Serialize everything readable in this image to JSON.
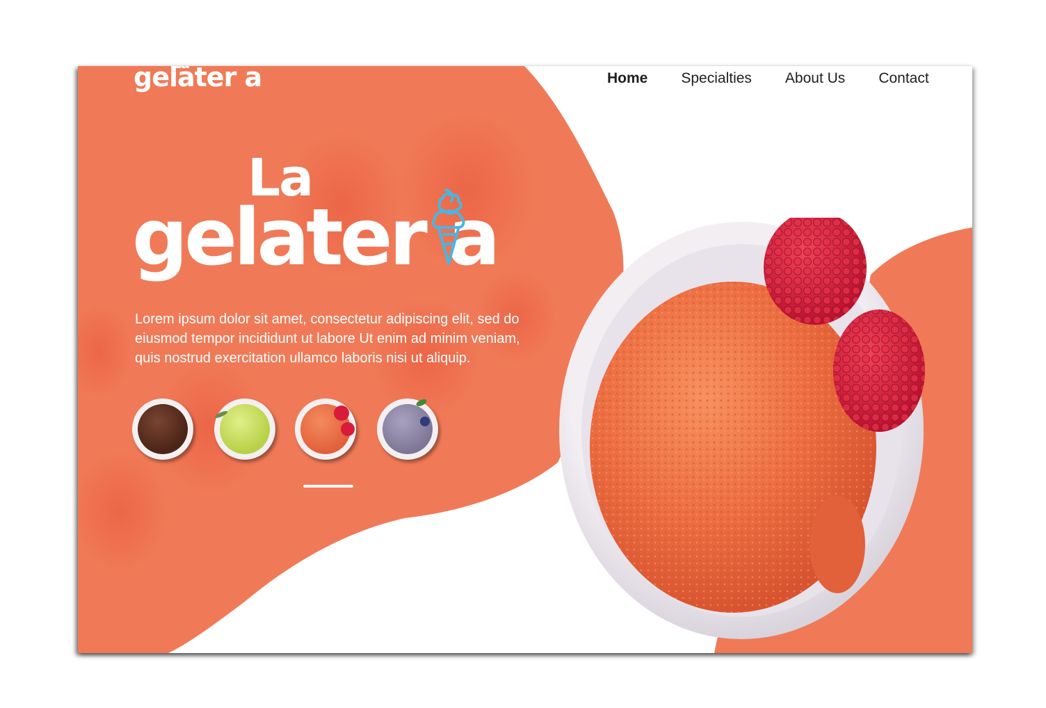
{
  "brand": {
    "logo_small_top": "La",
    "logo_small_main": "gelater a",
    "hero_top": "La",
    "hero_main": "gelater a"
  },
  "nav": {
    "items": [
      "Home",
      "Specialties",
      "About Us",
      "Contact"
    ],
    "active": "Home"
  },
  "hero": {
    "description": "Lorem ipsum dolor sit amet, consectetur adipiscing elit, sed do eiusmod tempor incididunt ut labore Ut enim ad minim veniam, quis nostrud exercitation ullamco laboris nisi ut aliquip."
  },
  "flavors": [
    {
      "name": "chocolate-gelato",
      "color": "#5a2f1f"
    },
    {
      "name": "pistachio-gelato",
      "color": "#c9e05a"
    },
    {
      "name": "strawberry-gelato",
      "color": "#ef7044"
    },
    {
      "name": "blueberry-gelato",
      "color": "#8e86a6"
    }
  ],
  "selected_flavor_index": 2,
  "colors": {
    "accent": "#f07a57",
    "accent_dark": "#ea6a47",
    "text_light": "#ffffff",
    "nav_text": "#1f1f1f",
    "icon_blue": "#4bb5e0"
  },
  "icons": [
    "ice-cream-cone-icon"
  ]
}
